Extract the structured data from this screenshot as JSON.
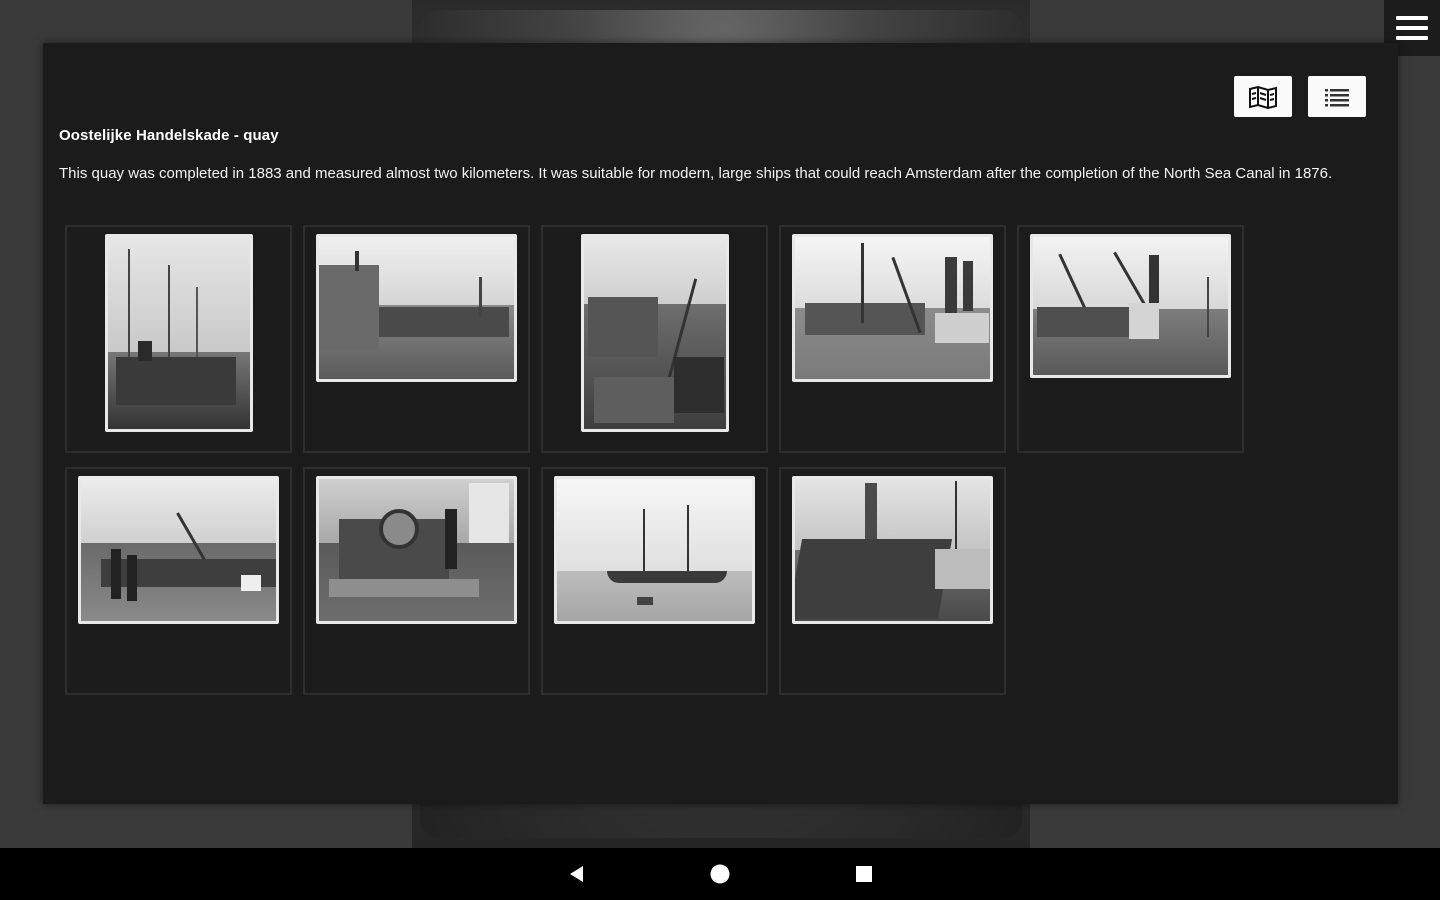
{
  "modal": {
    "title": "Oostelijke Handelskade - quay",
    "description": "This quay was completed in 1883 and measured almost two kilometers. It was suitable for modern, large ships that could reach Amsterdam after the completion of the North Sea Canal in 1876."
  },
  "view_toggle": {
    "buttons": [
      {
        "icon": "map-icon"
      },
      {
        "icon": "list-icon"
      }
    ]
  },
  "menu": {
    "icon": "hamburger-menu-icon"
  },
  "gallery": {
    "photos": [
      {
        "orientation": "portrait",
        "subject": "steamship-with-masts"
      },
      {
        "orientation": "landscape",
        "subject": "quay-warehouse"
      },
      {
        "orientation": "portrait",
        "subject": "quay-with-crane"
      },
      {
        "orientation": "landscape",
        "subject": "cranes-and-steamships"
      },
      {
        "orientation": "landscape",
        "subject": "cranes-and-ship-loading"
      },
      {
        "orientation": "landscape",
        "subject": "crowd-on-quay"
      },
      {
        "orientation": "landscape",
        "subject": "engine-room-machinery"
      },
      {
        "orientation": "landscape",
        "subject": "sailing-ship-on-water"
      },
      {
        "orientation": "landscape",
        "subject": "ship-wreckage-harbor"
      }
    ]
  },
  "navigation_bar": {
    "buttons": [
      {
        "icon": "back-triangle-icon"
      },
      {
        "icon": "home-circle-icon"
      },
      {
        "icon": "recents-square-icon"
      }
    ]
  }
}
